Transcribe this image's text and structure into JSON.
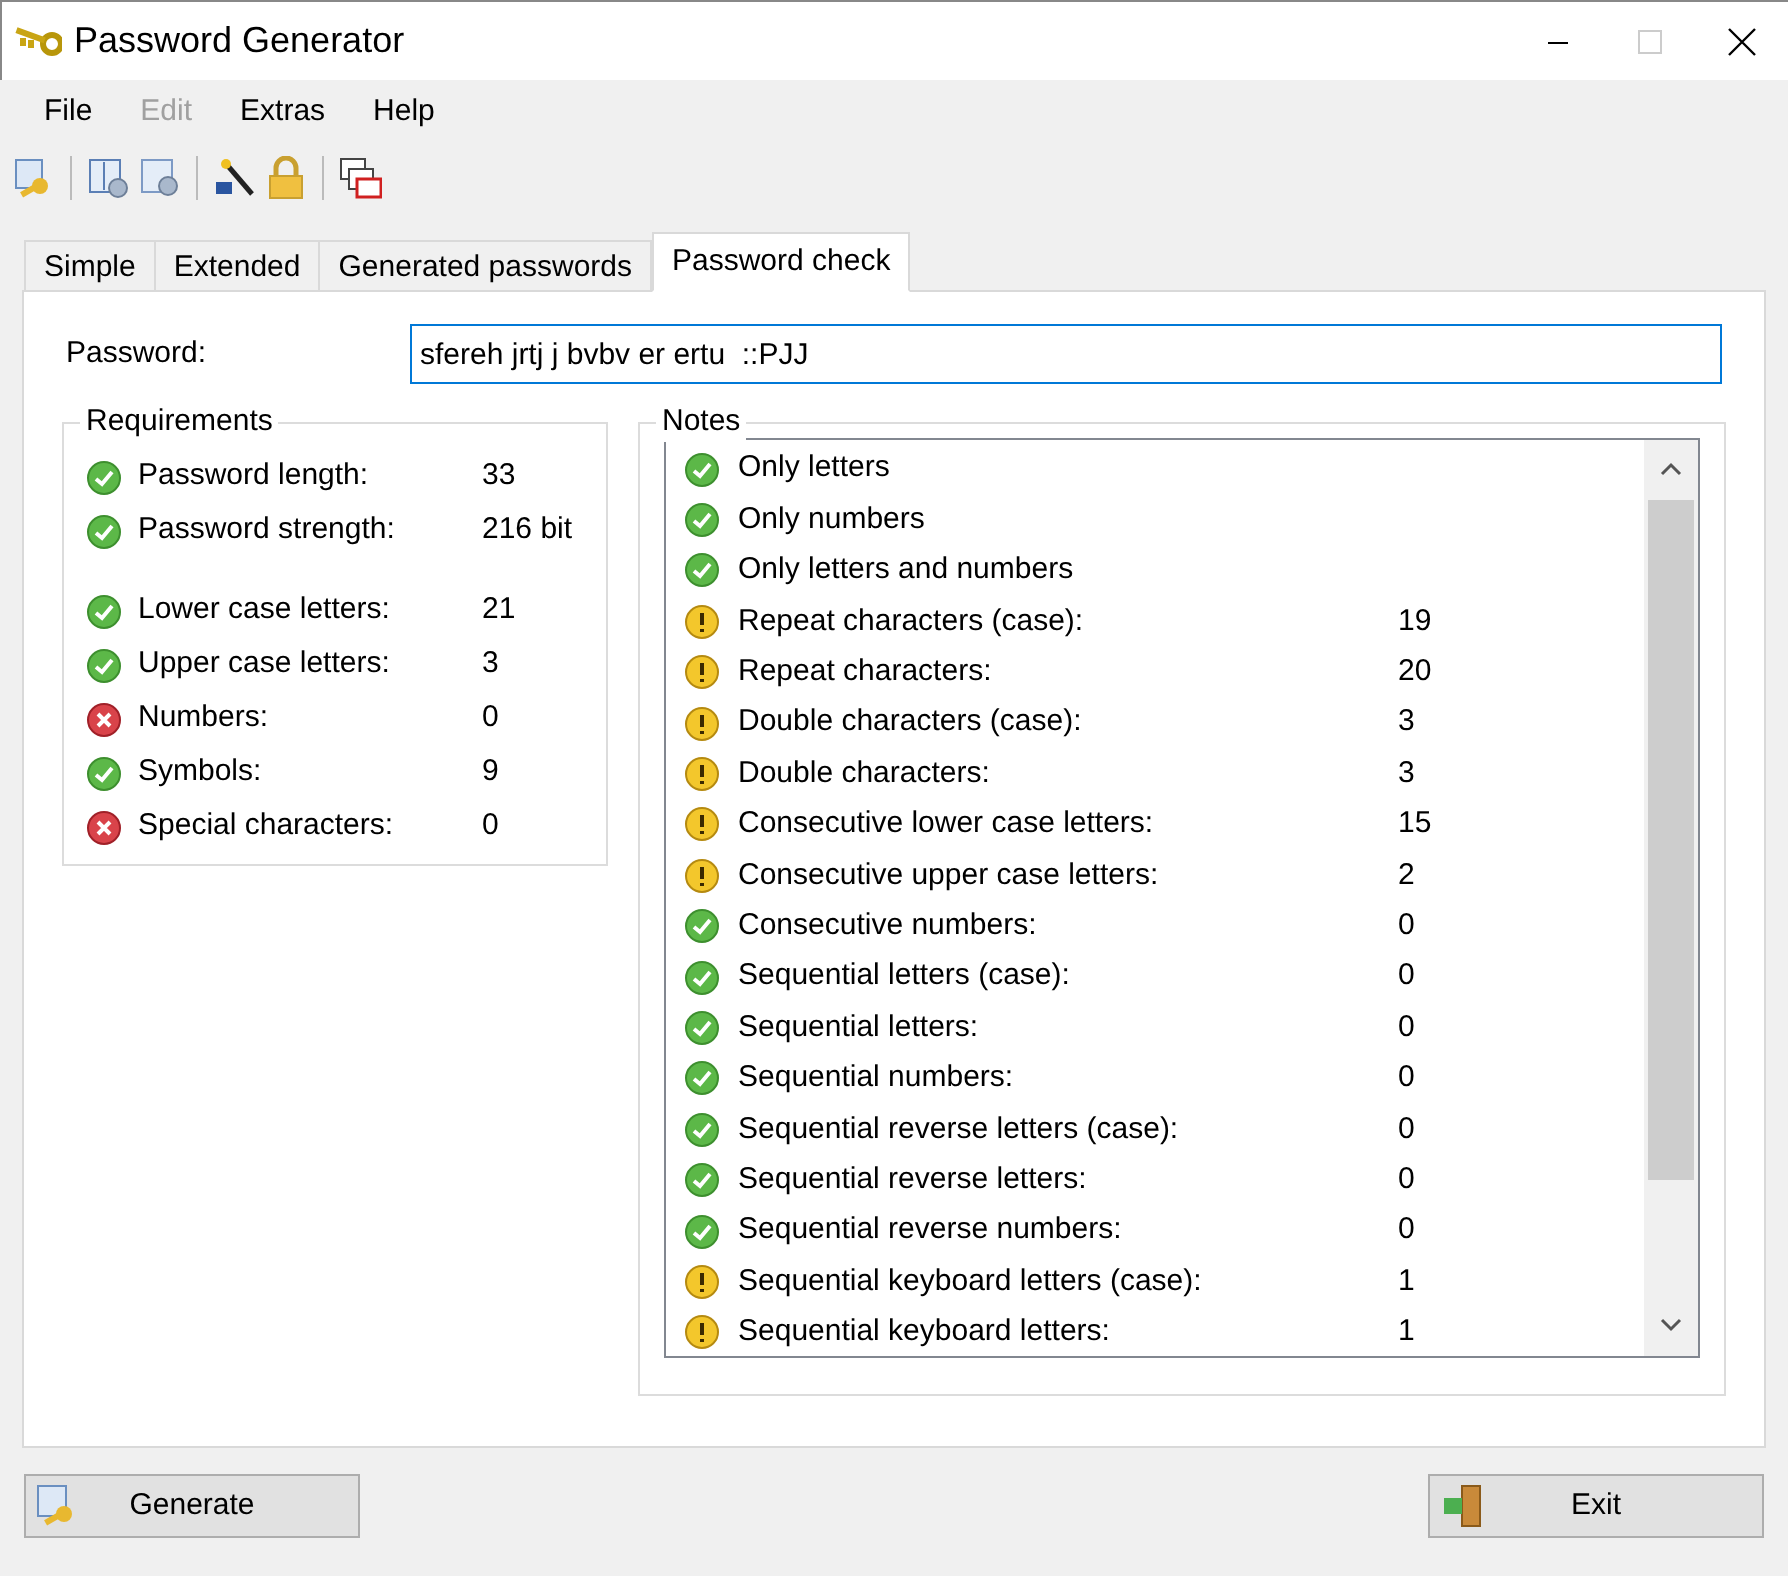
{
  "window": {
    "title": "Password Generator"
  },
  "menu": [
    {
      "label": "File",
      "disabled": false
    },
    {
      "label": "Edit",
      "disabled": true
    },
    {
      "label": "Extras",
      "disabled": false
    },
    {
      "label": "Help",
      "disabled": false
    }
  ],
  "tabs": [
    {
      "label": "Simple",
      "selected": false
    },
    {
      "label": "Extended",
      "selected": false
    },
    {
      "label": "Generated passwords",
      "selected": false
    },
    {
      "label": "Password check",
      "selected": true
    }
  ],
  "password": {
    "label": "Password:",
    "value": "sfereh jrtj j bvbv er ertu  ::PJJ"
  },
  "requirements": {
    "title": "Requirements",
    "items": [
      {
        "label": "Password length:",
        "value": "33",
        "kind": "ok"
      },
      {
        "label": "Password strength:",
        "value": "216 bit",
        "kind": "ok"
      },
      {
        "label": "Lower case letters:",
        "value": "21",
        "kind": "ok"
      },
      {
        "label": "Upper case letters:",
        "value": "3",
        "kind": "ok"
      },
      {
        "label": "Numbers:",
        "value": "0",
        "kind": "fail"
      },
      {
        "label": "Symbols:",
        "value": "9",
        "kind": "ok"
      },
      {
        "label": "Special characters:",
        "value": "0",
        "kind": "fail"
      }
    ]
  },
  "notes": {
    "title": "Notes",
    "items": [
      {
        "label": "Only letters",
        "kind": "ok"
      },
      {
        "label": "Only numbers",
        "kind": "ok"
      },
      {
        "label": "Only letters and numbers",
        "kind": "ok"
      },
      {
        "label": "Repeat characters (case):",
        "value": "19",
        "kind": "warn"
      },
      {
        "label": "Repeat characters:",
        "value": "20",
        "kind": "warn"
      },
      {
        "label": "Double characters (case):",
        "value": "3",
        "kind": "warn"
      },
      {
        "label": "Double characters:",
        "value": "3",
        "kind": "warn"
      },
      {
        "label": "Consecutive lower case letters:",
        "value": "15",
        "kind": "warn"
      },
      {
        "label": "Consecutive upper case letters:",
        "value": "2",
        "kind": "warn"
      },
      {
        "label": "Consecutive numbers:",
        "value": "0",
        "kind": "ok"
      },
      {
        "label": "Sequential letters (case):",
        "value": "0",
        "kind": "ok"
      },
      {
        "label": "Sequential letters:",
        "value": "0",
        "kind": "ok"
      },
      {
        "label": "Sequential numbers:",
        "value": "0",
        "kind": "ok"
      },
      {
        "label": "Sequential reverse letters (case):",
        "value": "0",
        "kind": "ok"
      },
      {
        "label": "Sequential reverse letters:",
        "value": "0",
        "kind": "ok"
      },
      {
        "label": "Sequential reverse numbers:",
        "value": "0",
        "kind": "ok"
      },
      {
        "label": "Sequential keyboard letters (case):",
        "value": "1",
        "kind": "warn"
      },
      {
        "label": "Sequential keyboard letters:",
        "value": "1",
        "kind": "warn"
      }
    ]
  },
  "buttons": [
    {
      "label": "Generate",
      "kind": "generate"
    },
    {
      "label": "Exit",
      "kind": "exit"
    }
  ]
}
